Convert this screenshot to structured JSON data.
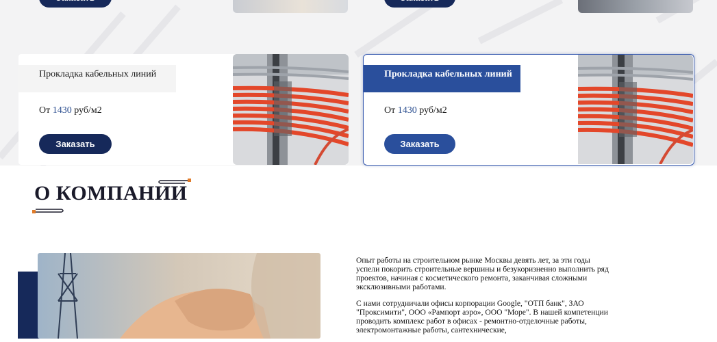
{
  "services": {
    "top_row": {
      "button_label": "Заказать"
    },
    "cards": [
      {
        "title": "Прокладка кабельных линий",
        "price_prefix": "От",
        "price_value": "1430",
        "price_unit": "руб/м2",
        "button_label": "Заказать",
        "highlighted": false
      },
      {
        "title": "Прокладка кабельных линий",
        "price_prefix": "От",
        "price_value": "1430",
        "price_unit": "руб/м2",
        "button_label": "Заказать",
        "highlighted": true
      }
    ]
  },
  "about": {
    "title": "О КОМПАНИИ",
    "paragraphs": [
      "Опыт работы на строительном рынке Москвы девять лет, за эти годы успели покорить строительные вершины и безукоризненно выполнить ряд проектов, начиная с косметического ремонта, заканчивая сложными эксклюзивными работами.",
      "С нами сотрудничали офисы корпорации Google, \"ОТП банк\", ЗАО \"Проксимити\", ООО «Рампорт аэро», ООО \"Море\". В нашей компетенции проводить комплекс работ в офисах - ремонтно-отделочные работы, электромонтажные работы, сантехнические,"
    ]
  },
  "colors": {
    "navy": "#16295a",
    "accent_blue": "#2a4f9c",
    "price_blue": "#2a4d8f",
    "title_gray_bg": "#f4f4f4"
  }
}
